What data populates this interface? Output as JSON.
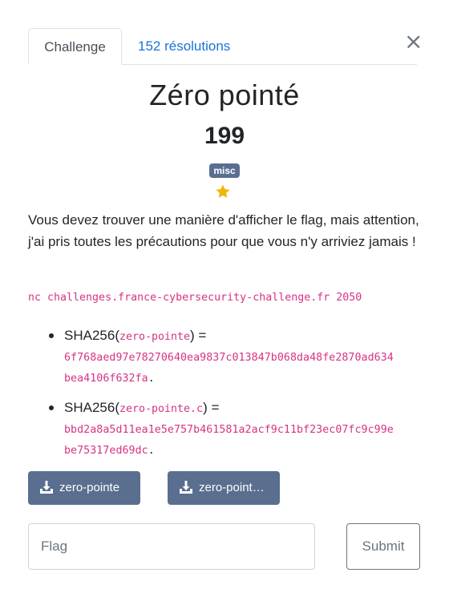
{
  "tabs": [
    {
      "label": "Challenge",
      "active": true
    },
    {
      "label": "152 résolutions",
      "active": false
    }
  ],
  "close_glyph": "×",
  "challenge": {
    "title": "Zéro pointé",
    "points": "199",
    "category": "misc",
    "difficulty_stars": 1,
    "description": "Vous devez trouver une manière d'afficher le flag, mais attention, j'ai pris toutes les précautions pour que vous n'y arriviez jamais !",
    "command": "nc challenges.france-cybersecurity-challenge.fr 2050"
  },
  "hashes": [
    {
      "prefix": "SHA256(",
      "file": "zero-pointe",
      "suffix": ") =",
      "hash_line1": "6f768aed97e78270640ea9837c013847b068da48fe2870ad634",
      "hash_line2": "bea4106f632fa",
      "end": "."
    },
    {
      "prefix": "SHA256(",
      "file": "zero-pointe.c",
      "suffix": ") =",
      "hash_line1": "bbd2a8a5d11ea1e5e757b461581a2acf9c11bf23ec07fc9c99e",
      "hash_line2": "be75317ed69dc",
      "end": "."
    }
  ],
  "downloads": [
    {
      "label": "zero-pointe"
    },
    {
      "label": "zero-point…"
    }
  ],
  "form": {
    "flag_placeholder": "Flag",
    "submit_label": "Submit"
  },
  "colors": {
    "link": "#1a73d9",
    "badge_bg": "#5a6f8f",
    "code": "#d63384",
    "star": "#f2b600"
  }
}
